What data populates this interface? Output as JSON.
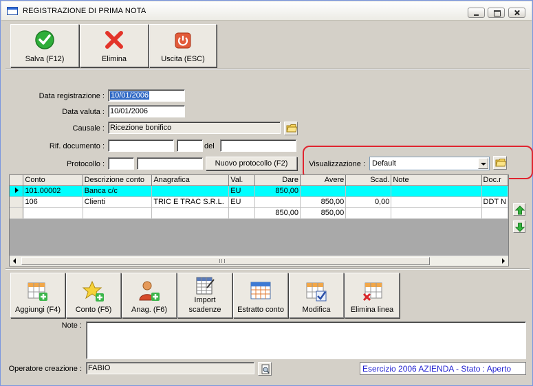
{
  "window": {
    "title": "REGISTRAZIONE DI PRIMA NOTA"
  },
  "toolbar": {
    "save_label": "Salva (F12)",
    "delete_label": "Elimina",
    "exit_label": "Uscita (ESC)"
  },
  "form": {
    "data_registrazione_label": "Data registrazione :",
    "data_registrazione_value": "10/01/2006",
    "data_valuta_label": "Data valuta :",
    "data_valuta_value": "10/01/2006",
    "causale_label": "Causale :",
    "causale_value": "Ricezione bonifico",
    "rif_documento_label": "Rif. documento :",
    "del_label": "del",
    "protocollo_label": "Protocollo :",
    "nuovo_protocollo_label": "Nuovo protocollo (F2)",
    "visualizzazione_label": "Visualizzazione :",
    "visualizzazione_value": "Default"
  },
  "grid": {
    "columns": [
      "Conto",
      "Descrizione conto",
      "Anagrafica",
      "Val.",
      "Dare",
      "Avere",
      "Scad.",
      "Note",
      "Doc.r"
    ],
    "rows": [
      {
        "conto": "101.00002",
        "descrizione": "Banca c/c",
        "anagrafica": "",
        "val": "EU",
        "dare": "850,00",
        "avere": "",
        "scad": "",
        "note": "",
        "doc": ""
      },
      {
        "conto": "106",
        "descrizione": "Clienti",
        "anagrafica": "TRIC E TRAC S.R.L.",
        "val": "EU",
        "dare": "",
        "avere": "850,00",
        "scad": "0,00",
        "note": "",
        "doc": "DDT N"
      }
    ],
    "totals": {
      "dare": "850,00",
      "avere": "850,00"
    },
    "scroll_grip": "III"
  },
  "bottom_toolbar": {
    "aggiungi_label": "Aggiungi (F4)",
    "conto_label": "Conto (F5)",
    "anag_label": "Anag. (F6)",
    "import_line1": "Import",
    "import_line2": "scadenze",
    "estratto_label": "Estratto conto",
    "modifica_label": "Modifica",
    "elimina_linea_label": "Elimina linea"
  },
  "note_label": "Note :",
  "operatore_label": "Operatore creazione :",
  "operatore_value": "FABIO",
  "status_text": "Esercizio 2006 AZIENDA - Stato : Aperto",
  "colors": {
    "selection": "#316ac5",
    "active_row": "#00ffff",
    "highlight": "#e0242f",
    "status_text": "#1f1fd0"
  }
}
